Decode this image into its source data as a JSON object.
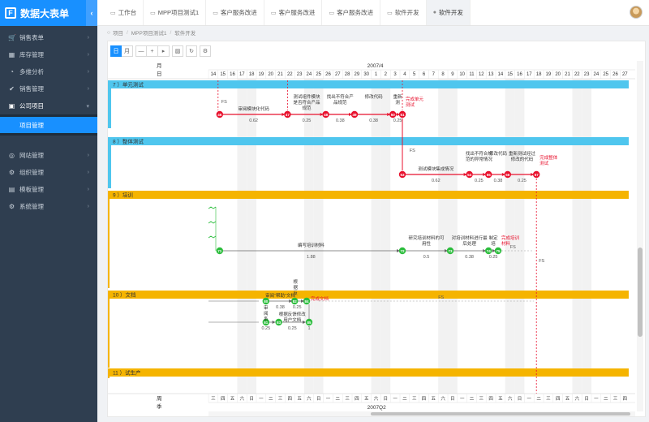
{
  "app": {
    "title": "数据大表单",
    "logo_letter": "F"
  },
  "sidebar": {
    "items": [
      {
        "label": "销售表单",
        "icon": "cart-icon",
        "glyph": "🛒"
      },
      {
        "label": "库存管理",
        "icon": "box-icon",
        "glyph": "▦"
      },
      {
        "label": "多维分析",
        "icon": "chart-icon",
        "glyph": "◔"
      },
      {
        "label": "销售管理",
        "icon": "check-icon",
        "glyph": "✔"
      },
      {
        "label": "公司项目",
        "icon": "briefcase-icon",
        "glyph": "▣"
      }
    ],
    "sub_item": "项目管理",
    "items2": [
      {
        "label": "网站管理",
        "icon": "globe-icon",
        "glyph": "◎"
      },
      {
        "label": "组织管理",
        "icon": "org-icon",
        "glyph": "⚙"
      },
      {
        "label": "模板管理",
        "icon": "template-icon",
        "glyph": "▤"
      },
      {
        "label": "系统管理",
        "icon": "settings-icon",
        "glyph": "⚙"
      }
    ]
  },
  "tabs": [
    {
      "label": "工作台",
      "icon": "monitor-icon"
    },
    {
      "label": "MPP项目测试1",
      "icon": "window-icon"
    },
    {
      "label": "客户服务改进",
      "icon": "window-icon"
    },
    {
      "label": "客户服务改进",
      "icon": "window-icon"
    },
    {
      "label": "客户服务改进",
      "icon": "window-icon"
    },
    {
      "label": "软件开发",
      "icon": "window-icon"
    },
    {
      "label": "软件开发",
      "icon": "dot-icon",
      "active": true
    }
  ],
  "breadcrumb": [
    "项目",
    "MPP项目测试1",
    "软件开发"
  ],
  "toolbar": {
    "day": "日",
    "month": "月",
    "minus": "—",
    "plus": "+",
    "next": "▸"
  },
  "timescale": {
    "month_label": "月",
    "day_label": "日",
    "month": "2007/4",
    "days": [
      "14",
      "15",
      "16",
      "17",
      "18",
      "19",
      "20",
      "21",
      "22",
      "23",
      "24",
      "25",
      "26",
      "27",
      "28",
      "29",
      "30",
      "1",
      "2",
      "3",
      "4",
      "5",
      "6",
      "7",
      "8",
      "9",
      "10",
      "11",
      "12",
      "13",
      "14",
      "15",
      "16",
      "17",
      "18",
      "19",
      "20",
      "21",
      "22",
      "23",
      "24",
      "25",
      "26",
      "27"
    ],
    "week_label": "周",
    "quarter_label": "季",
    "weekdays": [
      "三",
      "四",
      "五",
      "六",
      "日",
      "一",
      "二",
      "三",
      "四",
      "五",
      "六",
      "日",
      "一",
      "二",
      "三",
      "四",
      "五",
      "六",
      "日",
      "一",
      "二",
      "三",
      "四",
      "五",
      "六",
      "日",
      "一",
      "二",
      "三",
      "四",
      "五",
      "六",
      "日",
      "一",
      "二",
      "三",
      "四",
      "五",
      "六",
      "日",
      "一",
      "二",
      "三",
      "四"
    ],
    "quarter": "2007Q2"
  },
  "groups": [
    {
      "label": "7 ）单元测试",
      "color": "#4fc6ee"
    },
    {
      "label": "8 ）整体测试",
      "color": "#4fc6ee"
    },
    {
      "label": "9 ）培训",
      "color": "#f5b400"
    },
    {
      "label": "10 ）文档",
      "color": "#f5b400"
    },
    {
      "label": "11 ）试生产",
      "color": "#f5b400"
    }
  ],
  "nodes_g7": [
    {
      "id": "46",
      "task": "审阅模块化代码",
      "dur": "0.62"
    },
    {
      "id": "47",
      "task": "测试组件模块是否符合产品规范",
      "dur": "0.25"
    },
    {
      "id": "48",
      "task": "找出不符合产品规范",
      "dur": "0.38"
    },
    {
      "id": "49",
      "task": "修改代码",
      "dur": "0.38"
    },
    {
      "id": "50",
      "task": "重新测",
      "dur": "0.25"
    },
    {
      "id": "51",
      "task": "完成单元测试",
      "dur": ""
    }
  ],
  "nodes_g8": [
    {
      "id": "53",
      "task": "测试模块集成情况",
      "dur": "0.62"
    },
    {
      "id": "54",
      "task": "找出不符合规范的异常情况",
      "dur": "0.25"
    },
    {
      "id": "55",
      "task": "修改代码",
      "dur": "0.38"
    },
    {
      "id": "56",
      "task": "重新测试经过修改的代码",
      "dur": "0.25"
    },
    {
      "id": "57",
      "task": "完成整体测试",
      "dur": ""
    }
  ],
  "nodes_g9": [
    {
      "id": "71",
      "task": "编写培训材料",
      "dur": "1.88"
    },
    {
      "id": "72",
      "task": "研究培训材料的可用性",
      "dur": "0.5"
    },
    {
      "id": "73",
      "task": "对培训材料进行最后处理",
      "dur": "0.38"
    },
    {
      "id": "74",
      "task": "制定培",
      "dur": "0.25"
    },
    {
      "id": "75",
      "task": "完成培训材料",
      "dur": ""
    }
  ],
  "nodes_g10": [
    {
      "id": "80",
      "task": "审阅“帮助”文档",
      "dur": "0.38"
    },
    {
      "id": "81",
      "task": "审阅系",
      "dur": "0.25"
    },
    {
      "id": "82",
      "task": "根据反馈修改用户文档",
      "dur": "0.25"
    },
    {
      "id": "83",
      "task": "根据反",
      "dur": "0.25"
    },
    {
      "id": "84",
      "task": "完成文档",
      "dur": ""
    },
    {
      "id": "85",
      "task": "",
      "dur": "1"
    }
  ],
  "link_labels": {
    "fs": "FS"
  },
  "colors": {
    "accent": "#1890ff",
    "critical": "#e8112d",
    "normal": "#2bbd3c",
    "group_blue": "#4fc6ee",
    "group_orange": "#f5b400",
    "sidebar": "#2f3e50"
  }
}
